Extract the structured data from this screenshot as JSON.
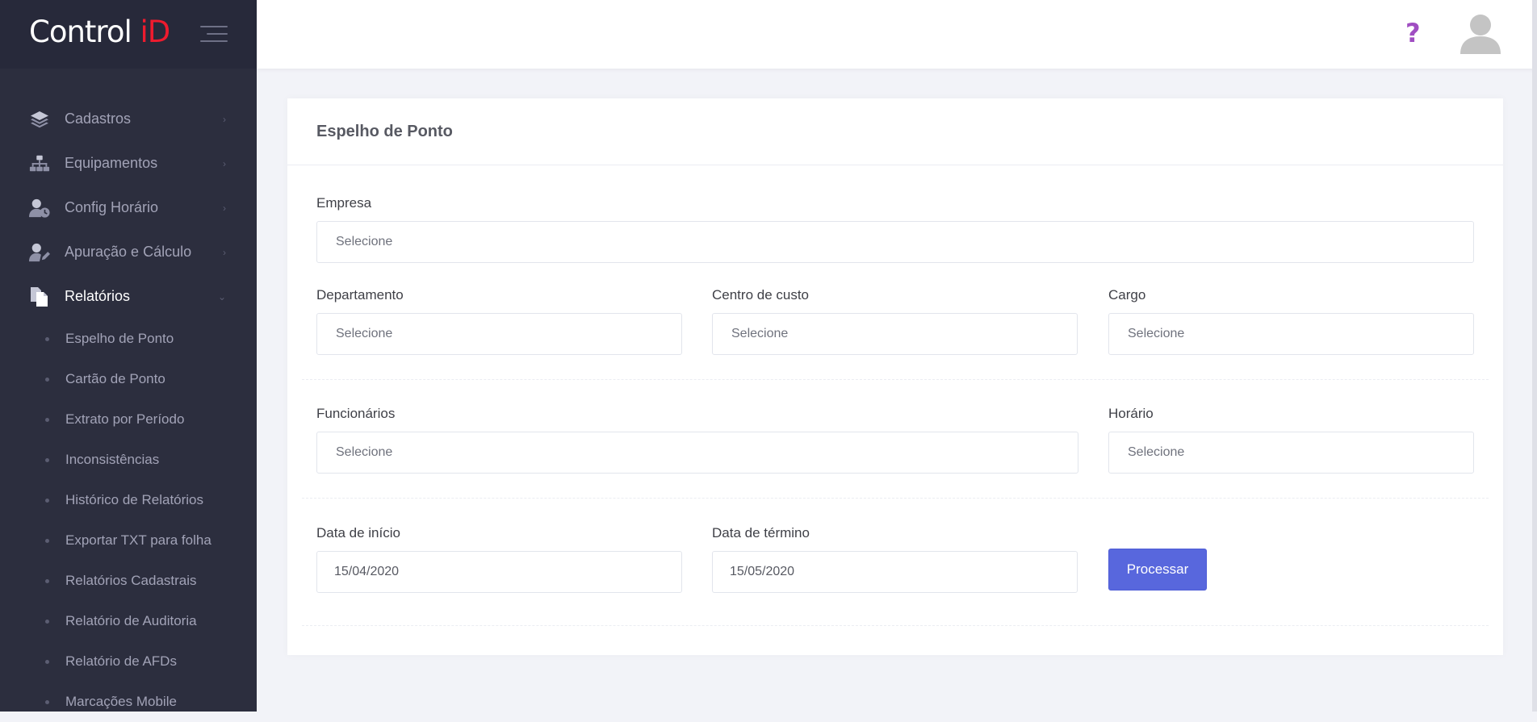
{
  "brand": {
    "logo_main": "Control ",
    "logo_accent": "iD"
  },
  "sidebar": {
    "menu": [
      {
        "label": "Cadastros",
        "icon": "layers-icon"
      },
      {
        "label": "Equipamentos",
        "icon": "sitemap-icon"
      },
      {
        "label": "Config Horário",
        "icon": "user-clock-icon"
      },
      {
        "label": "Apuração e Cálculo",
        "icon": "user-edit-icon"
      },
      {
        "label": "Relatórios",
        "icon": "copy-icon"
      }
    ],
    "submenu": [
      "Espelho de Ponto",
      "Cartão de Ponto",
      "Extrato por Período",
      "Inconsistências",
      "Histórico de Relatórios",
      "Exportar TXT para folha",
      "Relatórios Cadastrais",
      "Relatório de Auditoria",
      "Relatório de AFDs",
      "Marcações Mobile"
    ]
  },
  "header": {
    "help": "?"
  },
  "form": {
    "title": "Espelho de Ponto",
    "empresa": {
      "label": "Empresa",
      "value": "Selecione"
    },
    "departamento": {
      "label": "Departamento",
      "value": "Selecione"
    },
    "centro": {
      "label": "Centro de custo",
      "value": "Selecione"
    },
    "cargo": {
      "label": "Cargo",
      "value": "Selecione"
    },
    "funcionarios": {
      "label": "Funcionários",
      "value": "Selecione"
    },
    "horario": {
      "label": "Horário",
      "value": "Selecione"
    },
    "inicio": {
      "label": "Data de início",
      "value": "15/04/2020"
    },
    "termino": {
      "label": "Data de término",
      "value": "15/05/2020"
    },
    "submit": "Processar"
  },
  "colors": {
    "accent": "#5867dd",
    "brand_red": "#ed1b2e",
    "sidebar": "#2c2e3e",
    "help": "#a04ec2"
  }
}
